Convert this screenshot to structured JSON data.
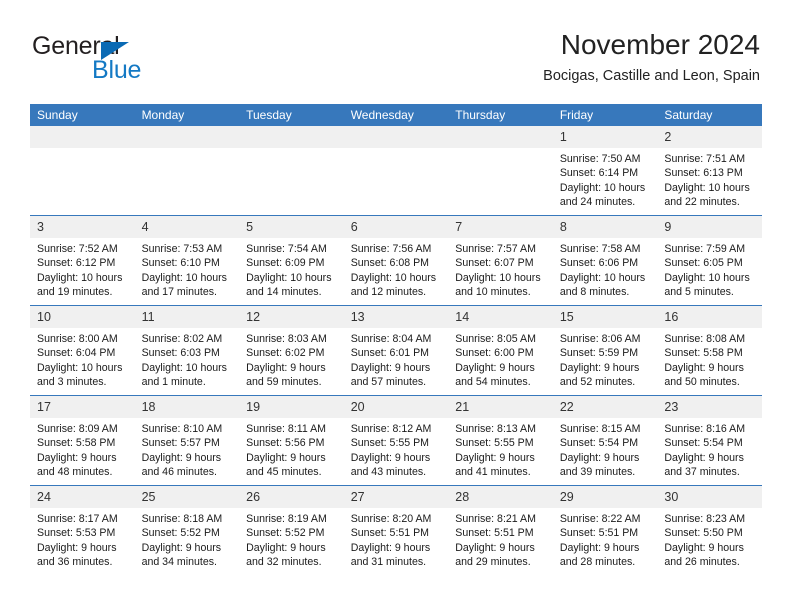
{
  "brand": {
    "name_part1": "General",
    "name_part2": "Blue",
    "triangle_color": "#0a6ab4",
    "blue_color": "#1479c4"
  },
  "header": {
    "month_title": "November 2024",
    "location": "Bocigas, Castille and Leon, Spain"
  },
  "theme": {
    "header_blue": "#3778bc",
    "daynum_band": "#f0f0f0",
    "text": "#1b1b1b"
  },
  "calendar": {
    "weekday_headers": [
      "Sunday",
      "Monday",
      "Tuesday",
      "Wednesday",
      "Thursday",
      "Friday",
      "Saturday"
    ],
    "weeks": [
      [
        {
          "day": "",
          "lines": []
        },
        {
          "day": "",
          "lines": []
        },
        {
          "day": "",
          "lines": []
        },
        {
          "day": "",
          "lines": []
        },
        {
          "day": "",
          "lines": []
        },
        {
          "day": "1",
          "lines": [
            "Sunrise: 7:50 AM",
            "Sunset: 6:14 PM",
            "Daylight: 10 hours",
            "and 24 minutes."
          ]
        },
        {
          "day": "2",
          "lines": [
            "Sunrise: 7:51 AM",
            "Sunset: 6:13 PM",
            "Daylight: 10 hours",
            "and 22 minutes."
          ]
        }
      ],
      [
        {
          "day": "3",
          "lines": [
            "Sunrise: 7:52 AM",
            "Sunset: 6:12 PM",
            "Daylight: 10 hours",
            "and 19 minutes."
          ]
        },
        {
          "day": "4",
          "lines": [
            "Sunrise: 7:53 AM",
            "Sunset: 6:10 PM",
            "Daylight: 10 hours",
            "and 17 minutes."
          ]
        },
        {
          "day": "5",
          "lines": [
            "Sunrise: 7:54 AM",
            "Sunset: 6:09 PM",
            "Daylight: 10 hours",
            "and 14 minutes."
          ]
        },
        {
          "day": "6",
          "lines": [
            "Sunrise: 7:56 AM",
            "Sunset: 6:08 PM",
            "Daylight: 10 hours",
            "and 12 minutes."
          ]
        },
        {
          "day": "7",
          "lines": [
            "Sunrise: 7:57 AM",
            "Sunset: 6:07 PM",
            "Daylight: 10 hours",
            "and 10 minutes."
          ]
        },
        {
          "day": "8",
          "lines": [
            "Sunrise: 7:58 AM",
            "Sunset: 6:06 PM",
            "Daylight: 10 hours",
            "and 8 minutes."
          ]
        },
        {
          "day": "9",
          "lines": [
            "Sunrise: 7:59 AM",
            "Sunset: 6:05 PM",
            "Daylight: 10 hours",
            "and 5 minutes."
          ]
        }
      ],
      [
        {
          "day": "10",
          "lines": [
            "Sunrise: 8:00 AM",
            "Sunset: 6:04 PM",
            "Daylight: 10 hours",
            "and 3 minutes."
          ]
        },
        {
          "day": "11",
          "lines": [
            "Sunrise: 8:02 AM",
            "Sunset: 6:03 PM",
            "Daylight: 10 hours",
            "and 1 minute."
          ]
        },
        {
          "day": "12",
          "lines": [
            "Sunrise: 8:03 AM",
            "Sunset: 6:02 PM",
            "Daylight: 9 hours",
            "and 59 minutes."
          ]
        },
        {
          "day": "13",
          "lines": [
            "Sunrise: 8:04 AM",
            "Sunset: 6:01 PM",
            "Daylight: 9 hours",
            "and 57 minutes."
          ]
        },
        {
          "day": "14",
          "lines": [
            "Sunrise: 8:05 AM",
            "Sunset: 6:00 PM",
            "Daylight: 9 hours",
            "and 54 minutes."
          ]
        },
        {
          "day": "15",
          "lines": [
            "Sunrise: 8:06 AM",
            "Sunset: 5:59 PM",
            "Daylight: 9 hours",
            "and 52 minutes."
          ]
        },
        {
          "day": "16",
          "lines": [
            "Sunrise: 8:08 AM",
            "Sunset: 5:58 PM",
            "Daylight: 9 hours",
            "and 50 minutes."
          ]
        }
      ],
      [
        {
          "day": "17",
          "lines": [
            "Sunrise: 8:09 AM",
            "Sunset: 5:58 PM",
            "Daylight: 9 hours",
            "and 48 minutes."
          ]
        },
        {
          "day": "18",
          "lines": [
            "Sunrise: 8:10 AM",
            "Sunset: 5:57 PM",
            "Daylight: 9 hours",
            "and 46 minutes."
          ]
        },
        {
          "day": "19",
          "lines": [
            "Sunrise: 8:11 AM",
            "Sunset: 5:56 PM",
            "Daylight: 9 hours",
            "and 45 minutes."
          ]
        },
        {
          "day": "20",
          "lines": [
            "Sunrise: 8:12 AM",
            "Sunset: 5:55 PM",
            "Daylight: 9 hours",
            "and 43 minutes."
          ]
        },
        {
          "day": "21",
          "lines": [
            "Sunrise: 8:13 AM",
            "Sunset: 5:55 PM",
            "Daylight: 9 hours",
            "and 41 minutes."
          ]
        },
        {
          "day": "22",
          "lines": [
            "Sunrise: 8:15 AM",
            "Sunset: 5:54 PM",
            "Daylight: 9 hours",
            "and 39 minutes."
          ]
        },
        {
          "day": "23",
          "lines": [
            "Sunrise: 8:16 AM",
            "Sunset: 5:54 PM",
            "Daylight: 9 hours",
            "and 37 minutes."
          ]
        }
      ],
      [
        {
          "day": "24",
          "lines": [
            "Sunrise: 8:17 AM",
            "Sunset: 5:53 PM",
            "Daylight: 9 hours",
            "and 36 minutes."
          ]
        },
        {
          "day": "25",
          "lines": [
            "Sunrise: 8:18 AM",
            "Sunset: 5:52 PM",
            "Daylight: 9 hours",
            "and 34 minutes."
          ]
        },
        {
          "day": "26",
          "lines": [
            "Sunrise: 8:19 AM",
            "Sunset: 5:52 PM",
            "Daylight: 9 hours",
            "and 32 minutes."
          ]
        },
        {
          "day": "27",
          "lines": [
            "Sunrise: 8:20 AM",
            "Sunset: 5:51 PM",
            "Daylight: 9 hours",
            "and 31 minutes."
          ]
        },
        {
          "day": "28",
          "lines": [
            "Sunrise: 8:21 AM",
            "Sunset: 5:51 PM",
            "Daylight: 9 hours",
            "and 29 minutes."
          ]
        },
        {
          "day": "29",
          "lines": [
            "Sunrise: 8:22 AM",
            "Sunset: 5:51 PM",
            "Daylight: 9 hours",
            "and 28 minutes."
          ]
        },
        {
          "day": "30",
          "lines": [
            "Sunrise: 8:23 AM",
            "Sunset: 5:50 PM",
            "Daylight: 9 hours",
            "and 26 minutes."
          ]
        }
      ]
    ]
  }
}
